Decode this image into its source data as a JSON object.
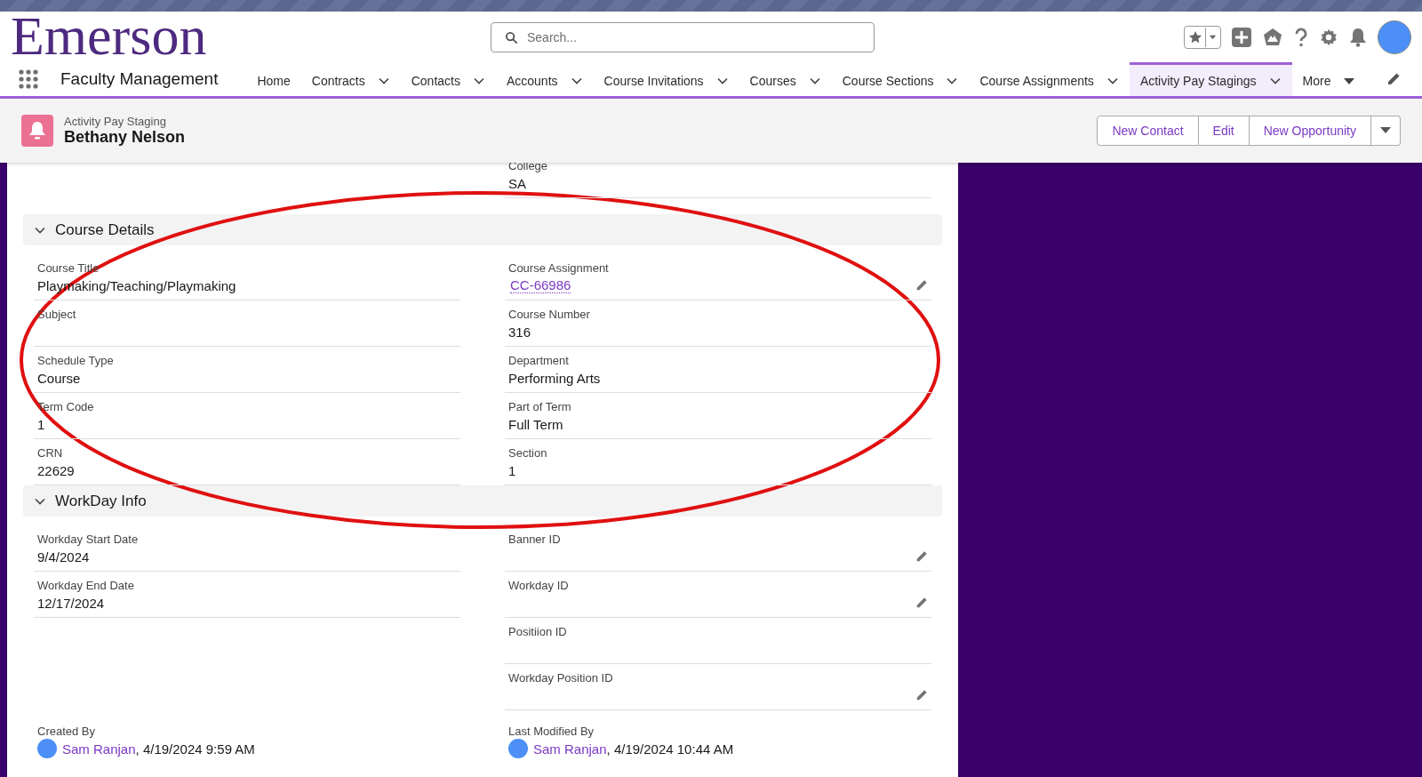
{
  "app": {
    "logo": "Emerson",
    "name": "Faculty Management"
  },
  "search": {
    "placeholder": "Search..."
  },
  "nav": [
    {
      "label": "Home",
      "kind": "plain",
      "selected": false
    },
    {
      "label": "Contracts",
      "kind": "dropdown",
      "selected": false
    },
    {
      "label": "Contacts",
      "kind": "dropdown",
      "selected": false
    },
    {
      "label": "Accounts",
      "kind": "dropdown",
      "selected": false
    },
    {
      "label": "Course Invitations",
      "kind": "dropdown",
      "selected": false
    },
    {
      "label": "Courses",
      "kind": "dropdown",
      "selected": false
    },
    {
      "label": "Course Sections",
      "kind": "dropdown",
      "selected": false
    },
    {
      "label": "Course Assignments",
      "kind": "dropdown",
      "selected": false
    },
    {
      "label": "Activity Pay Stagings",
      "kind": "dropdown",
      "selected": true
    },
    {
      "label": "More",
      "kind": "overflow",
      "selected": false
    }
  ],
  "record": {
    "type": "Activity Pay Staging",
    "name": "Bethany Nelson"
  },
  "actions": [
    "New Contact",
    "Edit",
    "New Opportunity"
  ],
  "top_field": {
    "label": "College",
    "value": "SA"
  },
  "sections": [
    {
      "title": "Course Details",
      "expanded": true,
      "left": [
        {
          "label": "Course Title",
          "kind": "text",
          "value": "Playmaking/Teaching/Playmaking",
          "editable": false
        },
        {
          "label": "Subject",
          "kind": "text",
          "editable": false
        },
        {
          "label": "Schedule Type",
          "kind": "text",
          "value": "Course",
          "editable": false
        },
        {
          "label": "Term Code",
          "kind": "text",
          "value": "1",
          "editable": false
        },
        {
          "label": "CRN",
          "kind": "text",
          "value": "22629",
          "editable": false
        }
      ],
      "right": [
        {
          "label": "Course Assignment",
          "kind": "link",
          "value": "CC-66986",
          "editable": true
        },
        {
          "label": "Course Number",
          "kind": "text",
          "value": "316",
          "editable": false
        },
        {
          "label": "Department",
          "kind": "text",
          "value": "Performing Arts",
          "editable": false
        },
        {
          "label": "Part of Term",
          "kind": "text",
          "value": "Full Term",
          "editable": false
        },
        {
          "label": "Section",
          "kind": "text",
          "value": "1",
          "editable": false
        }
      ]
    },
    {
      "title": "WorkDay Info",
      "expanded": true,
      "left": [
        {
          "label": "Workday Start Date",
          "kind": "text",
          "value": "9/4/2024",
          "editable": false
        },
        {
          "label": "Workday End Date",
          "kind": "text",
          "value": "12/17/2024",
          "editable": false
        }
      ],
      "right": [
        {
          "label": "Banner ID",
          "kind": "text",
          "editable": true
        },
        {
          "label": "Workday ID",
          "kind": "text",
          "editable": true
        },
        {
          "label": "Positiion ID",
          "kind": "text",
          "editable": false
        },
        {
          "label": "Workday Position ID",
          "kind": "text",
          "editable": true
        }
      ]
    }
  ],
  "system": [
    {
      "label": "Created By",
      "kind": "user",
      "user": "Sam Ranjan",
      "value": ", 4/19/2024 9:59 AM"
    },
    {
      "label": "Last Modified By",
      "kind": "user",
      "user": "Sam Ranjan",
      "value": ", 4/19/2024 10:44 AM"
    }
  ]
}
